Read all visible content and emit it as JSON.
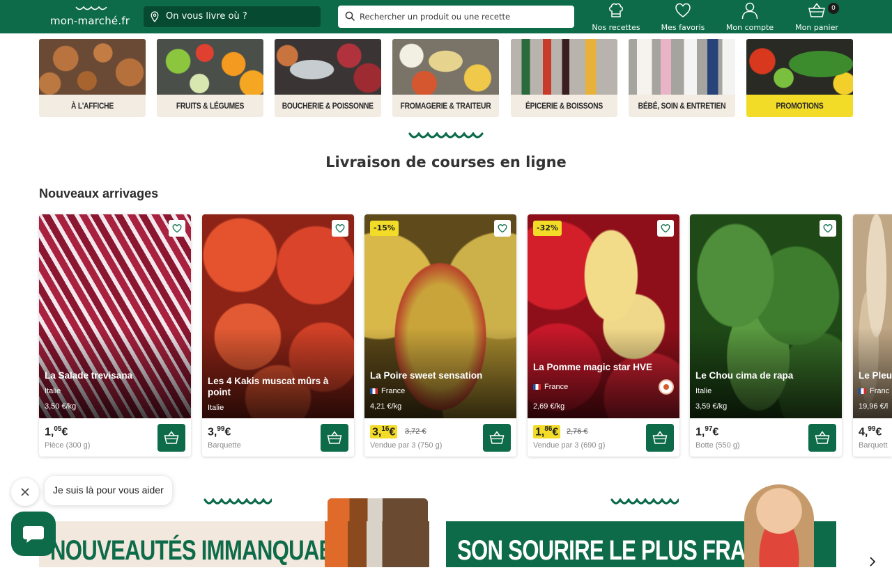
{
  "header": {
    "logo": "mon-marché.fr",
    "address_placeholder": "On vous livre où ?",
    "search_placeholder": "Rechercher un produit ou une recette",
    "nav": [
      {
        "label": "Nos recettes",
        "icon": "chef-hat-icon"
      },
      {
        "label": "Mes favoris",
        "icon": "heart-icon"
      },
      {
        "label": "Mon compte",
        "icon": "user-icon"
      },
      {
        "label": "Mon panier",
        "icon": "basket-icon"
      }
    ],
    "cart_count": "0",
    "colors": {
      "brand": "#0d6b4a",
      "address_bg": "#064a32"
    }
  },
  "categories": [
    {
      "label": "À L'AFFICHE"
    },
    {
      "label": "FRUITS & LÉGUMES"
    },
    {
      "label": "BOUCHERIE & POISSONNE..."
    },
    {
      "label": "FROMAGERIE & TRAITEUR"
    },
    {
      "label": "ÉPICERIE & BOISSONS"
    },
    {
      "label": "BÉBÉ, SOIN & ENTRETIEN"
    },
    {
      "label": "PROMOTIONS"
    }
  ],
  "main_title": "Livraison de courses en ligne",
  "section_title": "Nouveaux arrivages",
  "products": [
    {
      "name": "La Salade trevisana",
      "origin": "Italie",
      "price_per_kg": "3,50 €/kg",
      "price_int": "1,",
      "price_dec": "05",
      "price_cur": "€",
      "unit": "Pièce (300 g)"
    },
    {
      "name": "Les 4 Kakis muscat mûrs à point",
      "origin": "Italie",
      "price_int": "3,",
      "price_dec": "99",
      "price_cur": "€",
      "unit": "Barquette"
    },
    {
      "name": "La Poire sweet sensation",
      "origin": "France",
      "price_per_kg": "4,21 €/kg",
      "discount": "-15%",
      "price_int": "3,",
      "price_dec": "16",
      "price_cur": "€",
      "old_price": "3,72 €",
      "unit": "Vendue par 3 (750 g)"
    },
    {
      "name": "La Pomme magic star HVE",
      "origin": "France",
      "price_per_kg": "2,69 €/kg",
      "discount": "-32%",
      "price_int": "1,",
      "price_dec": "86",
      "price_cur": "€",
      "old_price": "2,76 €",
      "unit": "Vendue par 3 (690 g)"
    },
    {
      "name": "Le Chou cima de rapa",
      "origin": "Italie",
      "price_per_kg": "3,59 €/kg",
      "price_int": "1,",
      "price_dec": "97",
      "price_cur": "€",
      "unit": "Botte (550 g)"
    },
    {
      "name": "Le Pleu",
      "origin": "Franc",
      "price_per_kg": "19,96 €/l",
      "price_int": "4,",
      "price_dec": "99",
      "price_cur": "€",
      "unit": "Barquett"
    }
  ],
  "banners": [
    {
      "text": "NOUVEAUTÉS IMMANQUABLES"
    },
    {
      "text": "SON SOURIRE LE PLUS FRAIS"
    }
  ],
  "chat": {
    "message": "Je suis là pour vous aider"
  },
  "colors": {
    "promo_yellow": "#f2dc27",
    "brand_green": "#0d6b4a"
  }
}
